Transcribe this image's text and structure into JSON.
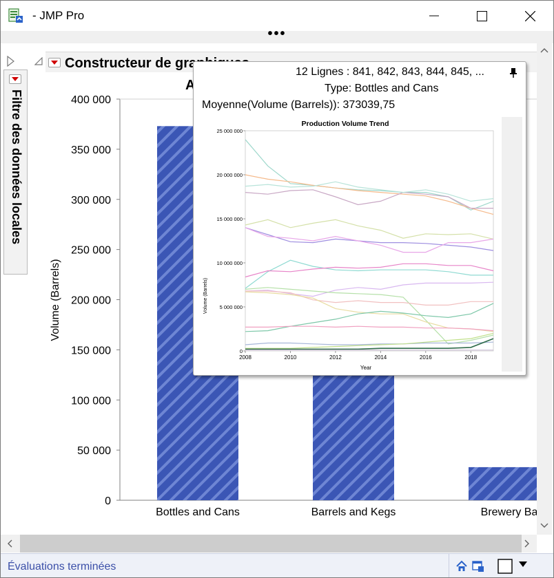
{
  "window": {
    "title": "- JMP Pro",
    "grip": "•••"
  },
  "filter_panel": {
    "label": "Filtre des données locales"
  },
  "outline": {
    "title": "Constructeur de graphiques"
  },
  "graph": {
    "title_visible": "A"
  },
  "chart_data": {
    "type": "bar",
    "title": "",
    "ylabel": "Volume (Barrels)",
    "xlabel": "",
    "ylim": [
      0,
      400000
    ],
    "yticks": [
      "0",
      "50 000",
      "100 000",
      "150 000",
      "200 000",
      "250 000",
      "300 000",
      "350 000",
      "400 000"
    ],
    "categories": [
      "Bottles and Cans",
      "Barrels and Kegs",
      "Brewery Ba"
    ],
    "values": [
      373039.75,
      310000,
      33000
    ],
    "bar_color": "#3b56b5",
    "pattern": "diagonal-stripes"
  },
  "tooltip": {
    "rows_label": "12 Lignes :  841, 842, 843, 844, 845, ...",
    "type_label": "Type:",
    "type_value": "Bottles and Cans",
    "mean_label": "Moyenne(Volume (Barrels)):",
    "mean_value": "373039,75",
    "mini_chart": {
      "type": "line",
      "title": "Production Volume Trend",
      "xlabel": "Year",
      "ylabel": "Volume (Barrels)",
      "xlim": [
        2008,
        2019
      ],
      "ylim": [
        0,
        25000000
      ],
      "xticks": [
        "2008",
        "2010",
        "2012",
        "2014",
        "2016",
        "2018"
      ],
      "yticks": [
        "0",
        "5 000 000",
        "10 000 000",
        "15 000 000",
        "20 000 000",
        "25 000 000"
      ],
      "x": [
        2008,
        2009,
        2010,
        2011,
        2012,
        2013,
        2014,
        2015,
        2016,
        2017,
        2018,
        2019
      ],
      "series": [
        {
          "color": "#9fd8cc",
          "values": [
            24000000,
            21000000,
            19000000,
            18800000,
            18500000,
            18300000,
            18200000,
            18000000,
            18000000,
            17500000,
            16000000,
            17000000
          ]
        },
        {
          "color": "#f5b98a",
          "values": [
            20000000,
            19500000,
            19200000,
            18800000,
            18500000,
            18200000,
            18000000,
            17800000,
            17600000,
            17000000,
            16200000,
            15500000
          ]
        },
        {
          "color": "#c8a7c4",
          "values": [
            18000000,
            17800000,
            18200000,
            18300000,
            17500000,
            16600000,
            17000000,
            18000000,
            17800000,
            17500000,
            16200000,
            16200000
          ]
        },
        {
          "color": "#b7e3d9",
          "values": [
            18700000,
            18900000,
            18600000,
            18700000,
            19200000,
            18600000,
            18300000,
            18000000,
            18300000,
            17800000,
            17000000,
            17300000
          ]
        },
        {
          "color": "#d4e0a8",
          "values": [
            14300000,
            14900000,
            14000000,
            14500000,
            14900000,
            14200000,
            13700000,
            12800000,
            13300000,
            13200000,
            13300000,
            12700000
          ]
        },
        {
          "color": "#9e8ee0",
          "values": [
            14000000,
            13200000,
            12400000,
            12300000,
            12700000,
            12500000,
            12300000,
            12300000,
            12200000,
            12000000,
            11800000,
            11400000
          ]
        },
        {
          "color": "#e8a6e8",
          "values": [
            14000000,
            13000000,
            12800000,
            12500000,
            13000000,
            12500000,
            12000000,
            11200000,
            11200000,
            12300000,
            12300000,
            12700000
          ]
        },
        {
          "color": "#8fdad2",
          "values": [
            7100000,
            9000000,
            10300000,
            9600000,
            9200000,
            9100000,
            9200000,
            9200000,
            9200000,
            9000000,
            8600000,
            8600000
          ]
        },
        {
          "color": "#e784c8",
          "values": [
            8400000,
            9100000,
            9000000,
            9300000,
            9500000,
            9400000,
            9500000,
            9900000,
            9900000,
            9700000,
            9700000,
            9100000
          ]
        },
        {
          "color": "#d8b7f0",
          "values": [
            6800000,
            6900000,
            6500000,
            6200000,
            6900000,
            7200000,
            7000000,
            7500000,
            7700000,
            7700000,
            7700000,
            7800000
          ]
        },
        {
          "color": "#b5e0a8",
          "values": [
            7000000,
            7200000,
            7000000,
            6800000,
            6600000,
            6500000,
            6400000,
            6100000,
            3500000,
            800000,
            1200000,
            1800000
          ]
        },
        {
          "color": "#f1c0c0",
          "values": [
            6800000,
            6800000,
            6600000,
            5800000,
            5500000,
            5700000,
            5500000,
            5500000,
            5200000,
            5200000,
            5600000,
            5600000
          ]
        },
        {
          "color": "#e8dca0",
          "values": [
            6700000,
            6600000,
            6400000,
            6000000,
            4800000,
            4400000,
            4200000,
            4200000,
            3300000,
            2600000,
            2500000,
            2200000
          ]
        },
        {
          "color": "#7cc7a8",
          "values": [
            2200000,
            2300000,
            2800000,
            3200000,
            3600000,
            4200000,
            4500000,
            4300000,
            4000000,
            3800000,
            4200000,
            5400000
          ]
        },
        {
          "color": "#f0a0c0",
          "values": [
            2700000,
            2700000,
            2800000,
            2800000,
            2700000,
            2800000,
            2700000,
            2700000,
            2600000,
            2600000,
            2500000,
            2300000
          ]
        },
        {
          "color": "#a6b6d8",
          "values": [
            700000,
            900000,
            900000,
            800000,
            700000,
            700000,
            800000,
            800000,
            900000,
            900000,
            900000,
            1000000
          ]
        },
        {
          "color": "#c0e08a",
          "values": [
            300000,
            300000,
            300000,
            400000,
            500000,
            600000,
            700000,
            800000,
            1000000,
            1200000,
            1400000,
            2000000
          ]
        },
        {
          "color": "#2f6b4a",
          "values": [
            200000,
            200000,
            200000,
            200000,
            200000,
            200000,
            300000,
            300000,
            300000,
            300000,
            400000,
            1400000
          ]
        },
        {
          "color": "#d0c0d8",
          "values": [
            100000,
            100000,
            100000,
            100000,
            100000,
            100000,
            100000,
            100000,
            100000,
            100000,
            100000,
            100000
          ]
        }
      ]
    }
  },
  "status_bar": {
    "text": "Évaluations terminées"
  },
  "colors": {
    "accent": "#3b4fa8",
    "bar": "#3b56b5",
    "red_marker": "#d00000"
  }
}
